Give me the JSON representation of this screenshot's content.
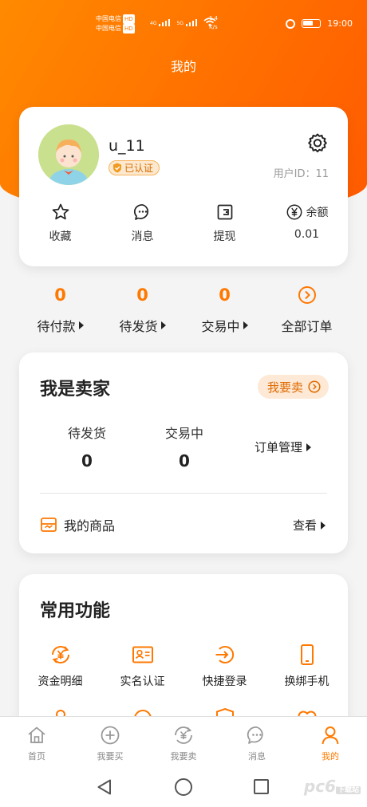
{
  "status_bar": {
    "carrier_1": "中国电信",
    "carrier_2": "中国电信",
    "hd_badge": "HD",
    "network_1": "4G",
    "network_2": "5G",
    "speed_value": "1.4",
    "speed_unit": "K/s",
    "battery_level": "62",
    "time": "19:00"
  },
  "header": {
    "title": "我的"
  },
  "profile": {
    "username": "u_11",
    "verified_label": "已认证",
    "user_id_label": "用户ID：11",
    "quick_actions": [
      {
        "label": "收藏",
        "icon": "star-icon"
      },
      {
        "label": "消息",
        "icon": "chat-icon"
      },
      {
        "label": "提现",
        "icon": "wallet-icon"
      }
    ],
    "balance": {
      "label": "余额",
      "value": "0.01",
      "icon": "yen-icon"
    }
  },
  "orders": [
    {
      "count": "0",
      "label": "待付款"
    },
    {
      "count": "0",
      "label": "待发货"
    },
    {
      "count": "0",
      "label": "交易中"
    },
    {
      "label": "全部订单",
      "icon": "arrow-circle-icon"
    }
  ],
  "seller": {
    "title": "我是卖家",
    "sell_button": "我要卖",
    "stats": [
      {
        "label": "待发货",
        "value": "0"
      },
      {
        "label": "交易中",
        "value": "0"
      }
    ],
    "manage_label": "订单管理",
    "goods_label": "我的商品",
    "view_label": "查看"
  },
  "functions": {
    "title": "常用功能",
    "items": [
      {
        "label": "资金明细",
        "icon": "fund-detail-icon"
      },
      {
        "label": "实名认证",
        "icon": "id-card-icon"
      },
      {
        "label": "快捷登录",
        "icon": "login-icon"
      },
      {
        "label": "换绑手机",
        "icon": "phone-icon"
      }
    ]
  },
  "tabbar": {
    "items": [
      {
        "label": "首页",
        "icon": "home-icon"
      },
      {
        "label": "我要买",
        "icon": "plus-circle-icon"
      },
      {
        "label": "我要卖",
        "icon": "yen-cycle-icon"
      },
      {
        "label": "消息",
        "icon": "message-icon"
      },
      {
        "label": "我的",
        "icon": "person-icon"
      }
    ],
    "active_index": 4
  },
  "watermark": {
    "text": "pc6",
    "tag": "下载站"
  },
  "colors": {
    "accent": "#ff7a00",
    "header_bg": "#ff6f00",
    "text": "#222222"
  }
}
